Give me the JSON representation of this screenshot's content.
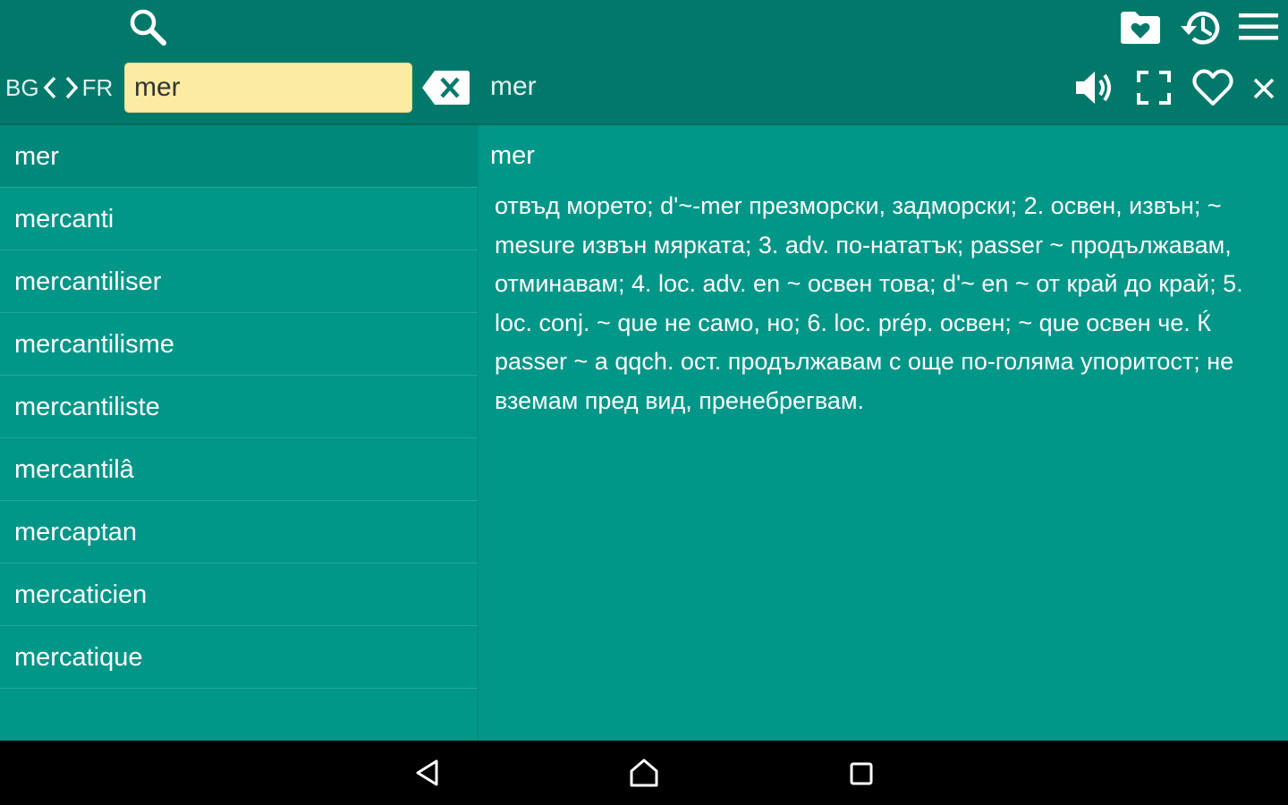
{
  "toolbar": {
    "source_lang": "BG",
    "target_lang": "FR",
    "search_value": "mer",
    "search_placeholder": "",
    "current_word": "mer",
    "icons": {
      "search": "search-icon",
      "favorites_folder": "favorites-folder-icon",
      "history": "history-icon",
      "menu": "menu-icon",
      "clear": "backspace-clear-icon",
      "speaker": "speaker-icon",
      "fullscreen": "fullscreen-icon",
      "favorite": "heart-icon",
      "close": "close-icon"
    }
  },
  "word_list": {
    "items": [
      "mer",
      "mercanti",
      "mercantiliser",
      "mercantilisme",
      "mercantiliste",
      "mercantilâ",
      "mercaptan",
      "mercaticien",
      "mercatique"
    ],
    "selected_index": 0
  },
  "definition": {
    "headword": "mer",
    "text": "отвъд морето; d'~-mer презморски, задморски; 2. освен, извън; ~ mesure извън мярката; 3. adv. по-нататък; passer ~ продължавам, отминавам; 4. loc. adv. en ~ освен това; d'~ en ~ от край до край; 5. loc. conj. ~ que не само, но; 6. loc. prép. освен; ~ que освен че. Ќ passer ~ a qqch. ост. продължавам с още по-голяма упоритост; не вземам пред вид, пренебрегвам."
  },
  "colors": {
    "toolbar": "#00796B",
    "content": "#009688",
    "selected_row": "#00897B",
    "search_field": "#FCECA3",
    "navbar": "#000000"
  },
  "navbar": {
    "icons": [
      "back-icon",
      "home-icon",
      "recents-icon"
    ]
  }
}
